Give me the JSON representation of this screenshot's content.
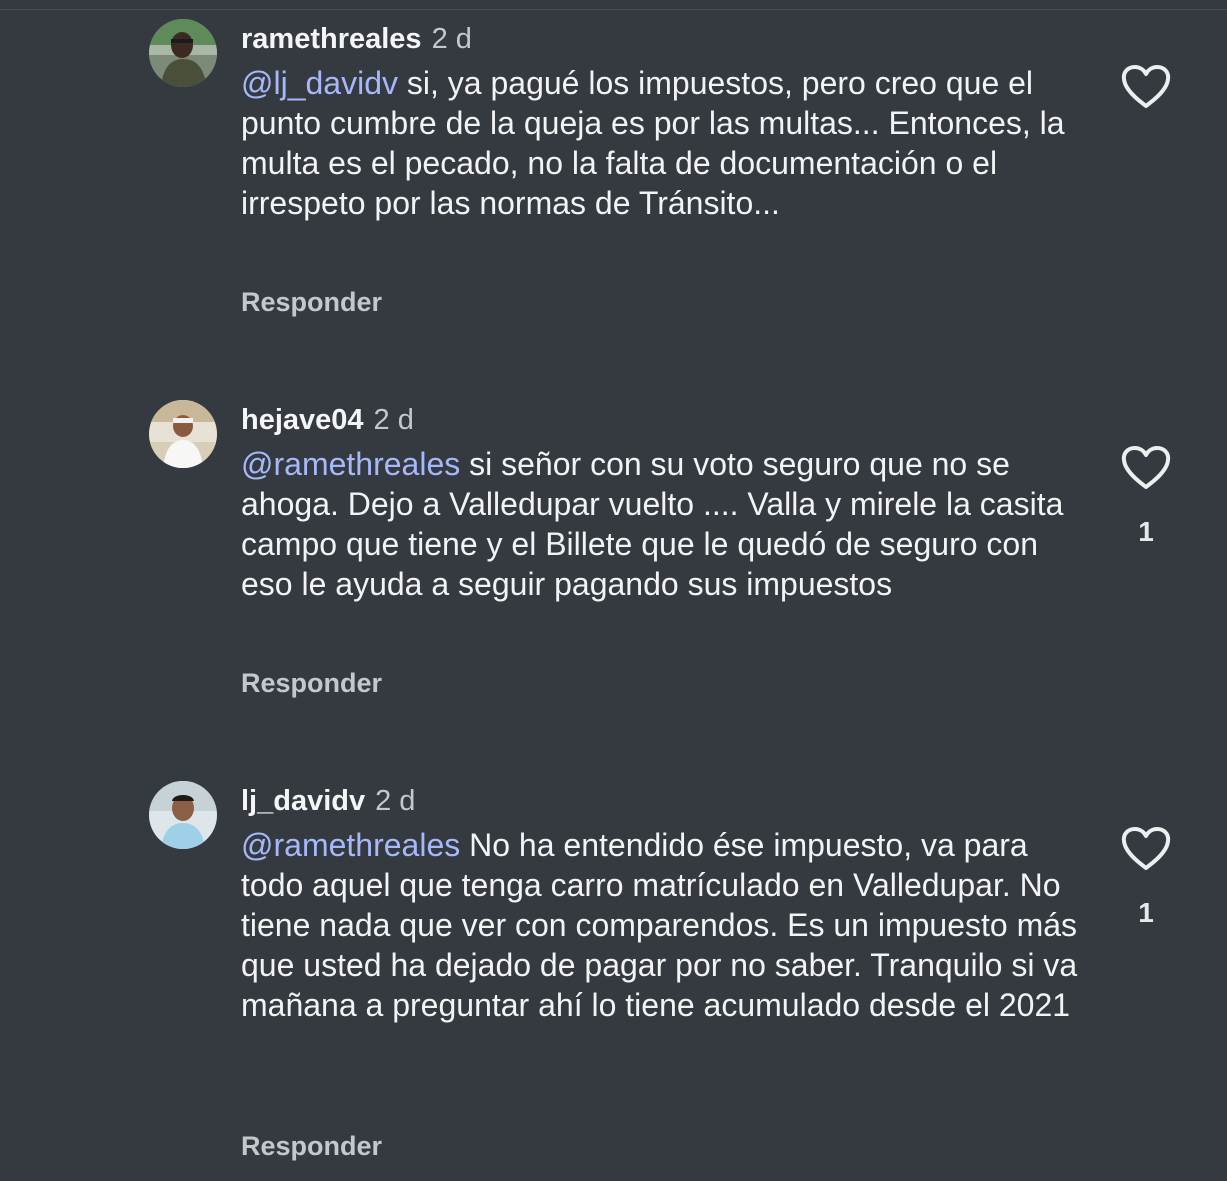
{
  "comments": [
    {
      "username": "ramethreales",
      "time": "2 d",
      "mention": "@lj_davidv",
      "body": " si, ya pagué los impuestos, pero creo que el punto cumbre de la queja es por las multas... Entonces, la multa es el pecado, no la falta de documentación o el irrespeto por las normas de Tránsito...",
      "reply_label": "Responder",
      "likes": ""
    },
    {
      "username": "hejave04",
      "time": "2 d",
      "mention": "@ramethreales",
      "body": " si señor con su voto seguro que no se ahoga. Dejo a Valledupar vuelto .... Valla y mirele la casita campo que tiene y el Billete que le quedó de seguro con eso le ayuda a seguir pagando sus impuestos",
      "reply_label": "Responder",
      "likes": "1"
    },
    {
      "username": "lj_davidv",
      "time": "2 d",
      "mention": "@ramethreales",
      "body": " No ha entendido ése impuesto, va para todo aquel que tenga carro matrículado en Valledupar. No tiene nada que ver con comparendos. Es un impuesto más que usted ha dejado de pagar por no saber. Tranquilo si va mañana a preguntar ahí lo tiene acumulado desde el 2021",
      "reply_label": "Responder",
      "likes": "1"
    }
  ],
  "icons": {
    "like": "heart-outline-icon"
  },
  "colors": {
    "background": "#343a3f",
    "mention": "#a6b8fa",
    "secondary_text": "#c4c8cc"
  }
}
